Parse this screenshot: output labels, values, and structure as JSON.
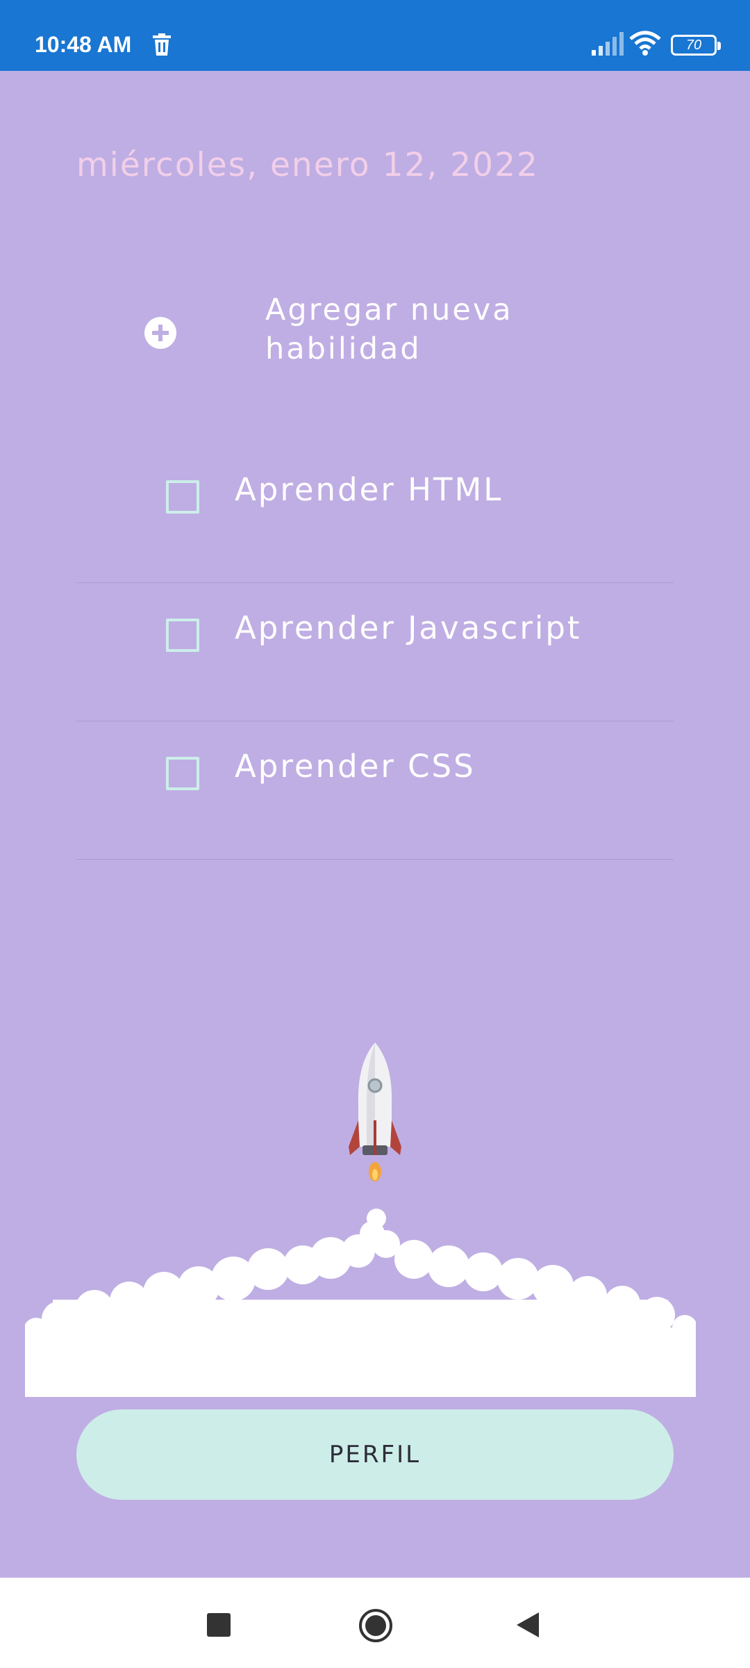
{
  "status_bar": {
    "time": "10:48 AM",
    "battery": "70",
    "icons": [
      "trash-icon",
      "signal-icon",
      "wifi-icon",
      "battery-icon"
    ]
  },
  "date": "miércoles, enero 12, 2022",
  "add_skill": {
    "label": "Agregar nueva habilidad",
    "icon": "plus-circle-icon"
  },
  "tasks": [
    {
      "label": "Aprender HTML",
      "checked": false
    },
    {
      "label": "Aprender Javascript",
      "checked": false
    },
    {
      "label": "Aprender CSS",
      "checked": false
    }
  ],
  "profile_button": "PERFIL",
  "colors": {
    "background": "#bfaee3",
    "status_bar": "#1976d2",
    "date_text": "#f2cfe9",
    "button": "#cdeee8",
    "checkbox": "#ccefea"
  },
  "nav_bar": {
    "icons": [
      "recent-apps-icon",
      "home-icon",
      "back-icon"
    ]
  }
}
